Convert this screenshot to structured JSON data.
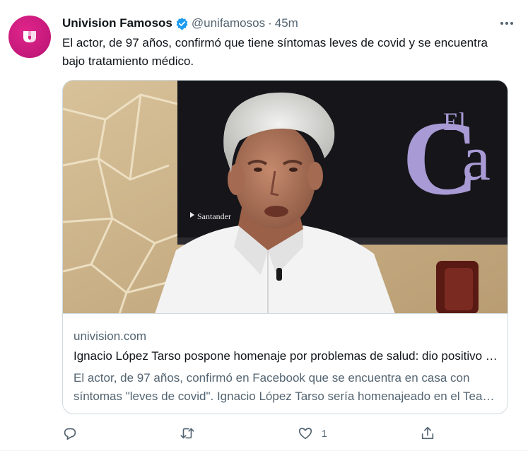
{
  "account": {
    "display_name": "Univision Famosos",
    "handle": "@unifamosos",
    "separator": "·",
    "time": "45m",
    "verified": true,
    "avatar_color": "#d81b83"
  },
  "tweet": {
    "text": "El actor, de 97 años, confirmó que tiene síntomas leves de covid y se encuentra bajo tratamiento médico."
  },
  "card": {
    "image_text_large": "C",
    "image_text_small": "El",
    "image_text_fragment": "a",
    "image_sponsor": "Santander",
    "domain": "univision.com",
    "title": "Ignacio López Tarso pospone homenaje por problemas de salud: dio positivo a covid",
    "description": "El actor, de 97 años, confirmó en Facebook que se encuentra en casa con síntomas \"leves de covid\". Ignacio López Tarso sería homenajeado en el Teatro Principal"
  },
  "actions": {
    "reply_icon": "reply-icon",
    "retweet_icon": "retweet-icon",
    "like_icon": "like-icon",
    "like_count": "1",
    "share_icon": "share-icon"
  },
  "colors": {
    "text_primary": "#0f1419",
    "text_secondary": "#536471",
    "border": "#cfd9de",
    "verified_blue": "#1d9bf0",
    "brand": "#d81b83"
  }
}
